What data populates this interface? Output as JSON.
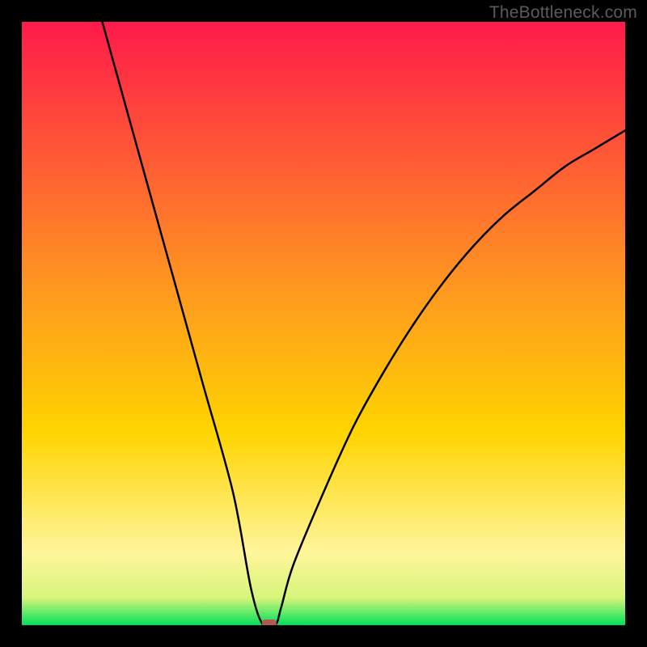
{
  "watermark": "TheBottleneck.com",
  "chart_data": {
    "type": "line",
    "title": "",
    "xlabel": "",
    "ylabel": "",
    "xlim": [
      0,
      100
    ],
    "ylim": [
      0,
      100
    ],
    "x": [
      0,
      5,
      10,
      15,
      20,
      25,
      30,
      35,
      38,
      40,
      42,
      43,
      45,
      50,
      55,
      60,
      65,
      70,
      75,
      80,
      85,
      90,
      95,
      100
    ],
    "values": [
      145,
      130,
      112,
      94,
      76,
      58,
      40,
      22,
      6,
      0,
      0,
      3,
      10,
      22,
      33,
      42,
      50,
      57,
      63,
      68,
      72,
      76,
      79,
      82
    ],
    "marker": {
      "x": 41,
      "y": 0
    },
    "gradient_top": "#ff1a4b",
    "gradient_mid": "#ffd400",
    "gradient_low": "#fff59b",
    "gradient_bottom": "#00e05a",
    "curve_color": "#000000",
    "marker_color": "#b25a52"
  }
}
